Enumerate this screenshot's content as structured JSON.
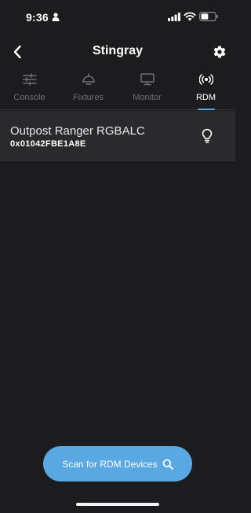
{
  "status_bar": {
    "time": "9:36"
  },
  "header": {
    "title": "Stingray",
    "back_icon": "chevron-left-icon",
    "settings_icon": "gear-icon"
  },
  "tabs": [
    {
      "label": "Console",
      "icon": "sliders-icon",
      "active": false
    },
    {
      "label": "Fixtures",
      "icon": "spotlight-icon",
      "active": false
    },
    {
      "label": "Monitor",
      "icon": "monitor-icon",
      "active": false
    },
    {
      "label": "RDM",
      "icon": "broadcast-icon",
      "active": true
    }
  ],
  "devices": [
    {
      "name": "Outpost Ranger RGBALC",
      "uid": "0x01042FBE1A8E",
      "action_icon": "lightbulb-icon"
    }
  ],
  "scan_button": {
    "label": "Scan for RDM Devices",
    "icon": "search-icon"
  },
  "colors": {
    "background": "#1c1c1e",
    "row_background": "#2a2a2c",
    "accent": "#5aa8e2",
    "inactive_tab": "#6e6e73"
  }
}
